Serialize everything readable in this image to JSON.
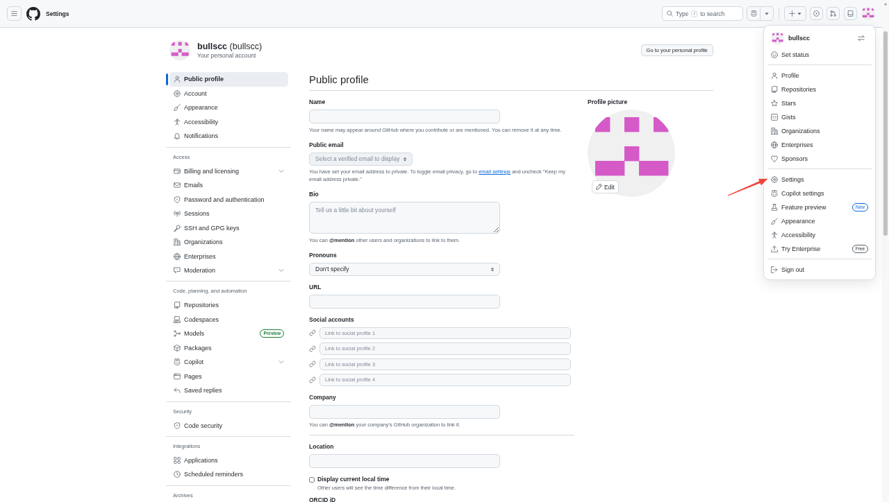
{
  "topbar": {
    "title": "Settings",
    "search": {
      "label": "Type",
      "key": "/",
      "label_after": "to search"
    }
  },
  "account": {
    "name": "bullscc",
    "login": "(bullscc)",
    "subtitle": "Your personal account",
    "profile_button": "Go to your personal profile"
  },
  "sidebar": {
    "groups": [
      {
        "items": [
          {
            "label": "Public profile",
            "selected": true
          },
          {
            "label": "Account",
            "selected": false
          },
          {
            "label": "Appearance",
            "selected": false
          },
          {
            "label": "Accessibility",
            "selected": false
          },
          {
            "label": "Notifications",
            "selected": false
          }
        ]
      },
      {
        "heading": "Access",
        "items": [
          {
            "label": "Billing and licensing",
            "selected": false,
            "expanded": false
          },
          {
            "label": "Emails",
            "selected": false
          },
          {
            "label": "Password and authentication",
            "selected": false
          },
          {
            "label": "Sessions",
            "selected": false
          },
          {
            "label": "SSH and GPG keys",
            "selected": false
          },
          {
            "label": "Organizations",
            "selected": false
          },
          {
            "label": "Enterprises",
            "selected": false
          },
          {
            "label": "Moderation",
            "selected": false,
            "expanded": false
          }
        ]
      },
      {
        "heading": "Code, planning, and automation",
        "items": [
          {
            "label": "Repositories",
            "selected": false
          },
          {
            "label": "Codespaces",
            "selected": false
          },
          {
            "label": "Models",
            "selected": false,
            "badge": {
              "text": "Preview",
              "kind": "success"
            }
          },
          {
            "label": "Packages",
            "selected": false
          },
          {
            "label": "Copilot",
            "selected": false,
            "expanded": false
          },
          {
            "label": "Pages",
            "selected": false
          },
          {
            "label": "Saved replies",
            "selected": false
          }
        ]
      },
      {
        "heading": "Security",
        "items": [
          {
            "label": "Code security",
            "selected": false
          }
        ]
      },
      {
        "heading": "Integrations",
        "items": [
          {
            "label": "Applications",
            "selected": false
          },
          {
            "label": "Scheduled reminders",
            "selected": false
          }
        ]
      },
      {
        "heading": "Archives"
      }
    ]
  },
  "profile": {
    "title": "Public profile",
    "fields": [
      {
        "kind": "text",
        "label": "Name",
        "help": "Your name may appear around GitHub where you contribute or are mentioned. You can remove it at any time."
      },
      {
        "kind": "picker",
        "label": "Public email",
        "value": "Select a verified email to display",
        "disabled": true,
        "help": "You have set your email address to private. To toggle email privacy, go to",
        "help_link": "email settings",
        "help_after": "and uncheck \"Keep my email address private.\""
      },
      {
        "kind": "textarea",
        "label": "Bio",
        "placeholder": "Tell us a little bit about yourself",
        "help": "You can **@mention** other users and organizations to link to them."
      },
      {
        "kind": "select",
        "label": "Pronouns",
        "value": "Don't specify",
        "disabled": false
      },
      {
        "kind": "text",
        "label": "URL"
      },
      {
        "kind": "social",
        "label": "Social accounts",
        "links": [
          {
            "placeholder": "Link to social profile 1"
          },
          {
            "placeholder": "Link to social profile 2"
          },
          {
            "placeholder": "Link to social profile 3"
          },
          {
            "placeholder": "Link to social profile 4"
          }
        ]
      },
      {
        "kind": "text",
        "label": "Company",
        "help": "You can **@mention** your company's GitHub organization to link it."
      },
      {
        "kind": "separator"
      },
      {
        "kind": "text",
        "label": "Location"
      },
      {
        "kind": "checkbox",
        "label": "Display current local time",
        "checked": false,
        "help": "Other users will see the time difference from their local time."
      },
      {
        "kind": "label",
        "label": "ORCID iD"
      }
    ],
    "picture": {
      "label": "Profile picture",
      "edit_button": "Edit"
    }
  },
  "user_menu": {
    "username": "bullscc",
    "sections": [
      {
        "items": [
          {
            "label": "Set status"
          }
        ]
      },
      {
        "items": [
          {
            "label": "Profile"
          },
          {
            "label": "Repositories"
          },
          {
            "label": "Stars"
          },
          {
            "label": "Gists"
          },
          {
            "label": "Organizations"
          },
          {
            "label": "Enterprises"
          },
          {
            "label": "Sponsors"
          }
        ]
      },
      {
        "items": [
          {
            "label": "Settings"
          },
          {
            "label": "Copilot settings"
          },
          {
            "label": "Feature preview",
            "badge": {
              "text": "New",
              "kind": "accent"
            }
          },
          {
            "label": "Appearance"
          },
          {
            "label": "Accessibility"
          },
          {
            "label": "Try Enterprise",
            "badge": {
              "text": "Free",
              "kind": "neutral"
            }
          }
        ]
      },
      {
        "items": [
          {
            "label": "Sign out"
          }
        ]
      }
    ]
  },
  "annotations": [
    {
      "kind": "arrow"
    }
  ]
}
